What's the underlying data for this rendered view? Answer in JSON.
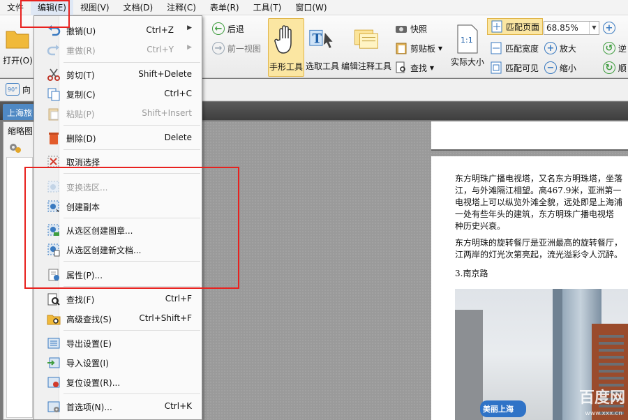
{
  "menubar": {
    "items": [
      {
        "label": "文件"
      },
      {
        "label": "编辑(E)",
        "active": true
      },
      {
        "label": "视图(V)"
      },
      {
        "label": "文档(D)"
      },
      {
        "label": "注释(C)"
      },
      {
        "label": "表单(R)"
      },
      {
        "label": "工具(T)"
      },
      {
        "label": "窗口(W)"
      }
    ]
  },
  "ribbon": {
    "open_label": "打开(O)",
    "back_label": "后退",
    "forward_label": "前一视图",
    "hand_tool": "手形工具",
    "select_tool": "选取工具",
    "edit_annot_tool": "编辑注释工具",
    "snapshot": "快照",
    "clipboard": "剪贴板",
    "find": "查找",
    "actual_size": "实际大小",
    "actual_size_icon_text": "1:1",
    "fit_page": "匹配页面",
    "fit_width": "匹配宽度",
    "fit_visible": "匹配可见",
    "zoom_value": "68.85%",
    "zoom_in": "放大",
    "zoom_out": "缩小",
    "rotate_ccw": "逆",
    "rotate_cw": "顺"
  },
  "strip2": {
    "rotate_label": "向",
    "rotate_badge": "90°"
  },
  "tabs": {
    "document_tab": "上海旅"
  },
  "sidebar": {
    "title": "缩略图"
  },
  "edit_menu": {
    "items": [
      {
        "label": "撤销(U)",
        "shortcut": "Ctrl+Z",
        "submenu": true,
        "disabled": false
      },
      {
        "label": "重做(R)",
        "shortcut": "Ctrl+Y",
        "submenu": true,
        "disabled": true
      },
      {
        "label": "剪切(T)",
        "shortcut": "Shift+Delete",
        "disabled": false
      },
      {
        "label": "复制(C)",
        "shortcut": "Ctrl+C",
        "disabled": false
      },
      {
        "label": "粘贴(P)",
        "shortcut": "Shift+Insert",
        "disabled": true
      },
      {
        "label": "删除(D)",
        "shortcut": "Delete",
        "disabled": false
      },
      {
        "label": "取消选择",
        "shortcut": "",
        "disabled": false
      },
      {
        "label": "变换选区...",
        "shortcut": "",
        "disabled": true
      },
      {
        "label": "创建副本",
        "shortcut": "",
        "disabled": false
      },
      {
        "label": "从选区创建图章...",
        "shortcut": "",
        "disabled": false
      },
      {
        "label": "从选区创建新文档...",
        "shortcut": "",
        "disabled": false
      },
      {
        "label": "属性(P)...",
        "shortcut": "",
        "disabled": false
      },
      {
        "label": "查找(F)",
        "shortcut": "Ctrl+F",
        "disabled": false
      },
      {
        "label": "高级查找(S)",
        "shortcut": "Ctrl+Shift+F",
        "disabled": false
      },
      {
        "label": "导出设置(E)",
        "shortcut": "",
        "disabled": false
      },
      {
        "label": "导入设置(I)",
        "shortcut": "",
        "disabled": false
      },
      {
        "label": "复位设置(R)...",
        "shortcut": "",
        "disabled": false
      },
      {
        "label": "首选项(N)...",
        "shortcut": "Ctrl+K",
        "disabled": false
      }
    ]
  },
  "document": {
    "para1": [
      "东方明珠广播电视塔，又名东方明珠塔，坐落",
      "江，与外滩隔江相望。高467.9米，亚洲第一",
      "电视塔上可以纵览外滩全貌，远处即是上海浦",
      "一处有些年头的建筑，东方明珠广播电视塔",
      "种历史兴衰。"
    ],
    "para2": [
      "东方明珠的旋转餐厅是亚洲最高的旋转餐厅，",
      "江两岸的灯光次第亮起，流光溢彩令人沉醉。"
    ],
    "heading": "3.南京路",
    "photo_sign": "美丽上海",
    "watermark": "百度网",
    "watermark_url": "www.xxx.cn"
  },
  "colors": {
    "highlight_red": "#e8211e",
    "ribbon_highlight": "#fbe6a2",
    "tab_blue": "#4f89c4"
  }
}
